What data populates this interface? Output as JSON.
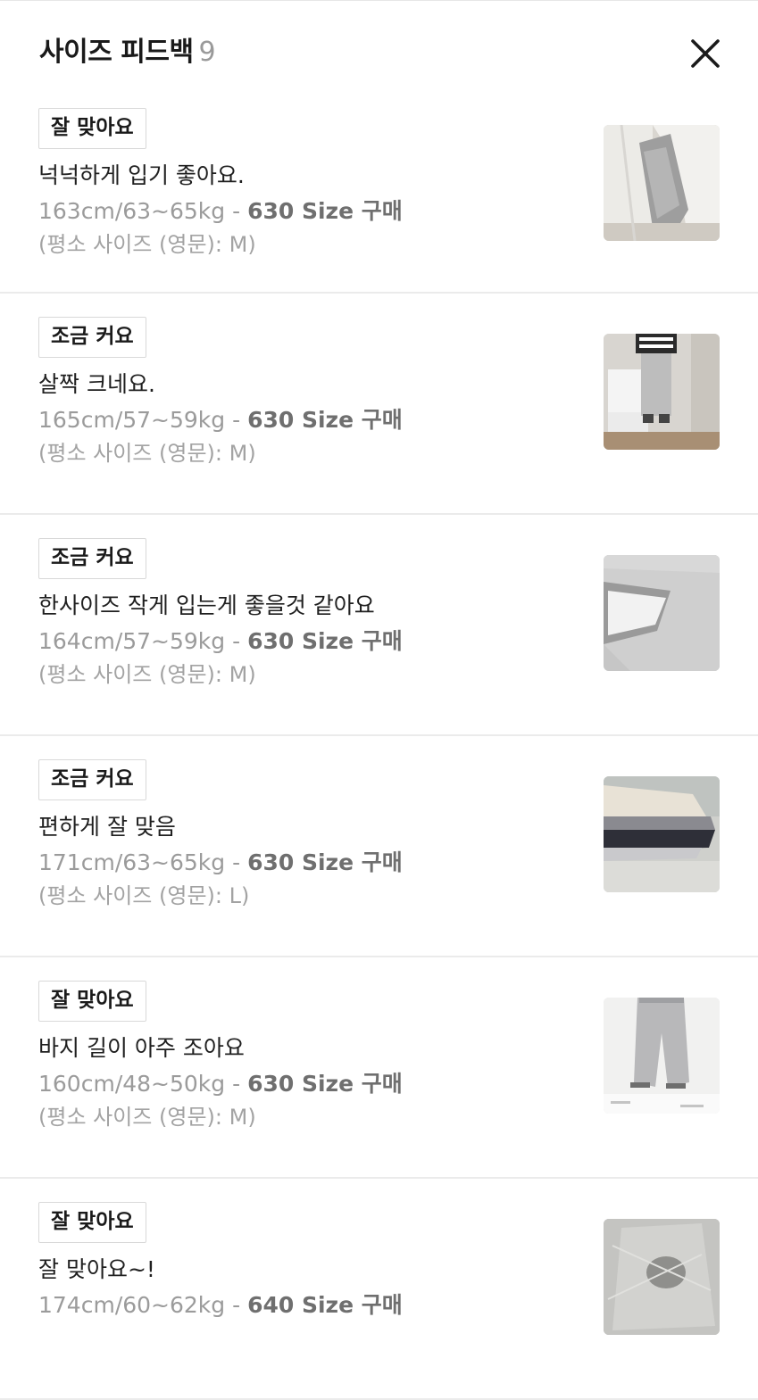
{
  "header": {
    "title": "사이즈 피드백",
    "count": "9",
    "close_icon": "close-icon"
  },
  "reviews": [
    {
      "fit": "잘 맞아요",
      "comment": "넉넉하게 입기 좋아요.",
      "body": "163cm/63~65kg -",
      "purchase": "630 Size 구매",
      "usual": "(평소 사이즈 (영문): M)",
      "photo": "photo-white-jacket-gray-knit"
    },
    {
      "fit": "조금 커요",
      "comment": "살짝 크네요.",
      "body": "165cm/57~59kg -",
      "purchase": "630 Size 구매",
      "usual": "(평소 사이즈 (영문): M)",
      "photo": "photo-mirror-selfie-gray-pants"
    },
    {
      "fit": "조금 커요",
      "comment": "한사이즈 작게 입는게 좋을것 같아요",
      "body": "164cm/57~59kg -",
      "purchase": "630 Size 구매",
      "usual": "(평소 사이즈 (영문): M)",
      "photo": "photo-gray-fabric-closeup"
    },
    {
      "fit": "조금 커요",
      "comment": "편하게 잘 맞음",
      "body": "171cm/63~65kg -",
      "purchase": "630 Size 구매",
      "usual": "(평소 사이즈 (영문): L)",
      "photo": "photo-folded-clothes-stack"
    },
    {
      "fit": "잘 맞아요",
      "comment": "바지 길이 아주 조아요",
      "body": "160cm/48~50kg -",
      "purchase": "630 Size 구매",
      "usual": "(평소 사이즈 (영문): M)",
      "photo": "photo-model-gray-wide-pants"
    },
    {
      "fit": "잘 맞아요",
      "comment": "잘 맞아요~!",
      "body": "174cm/60~62kg -",
      "purchase": "640 Size 구매",
      "usual": "",
      "photo": "photo-gray-fabric-plastic-bag"
    }
  ]
}
